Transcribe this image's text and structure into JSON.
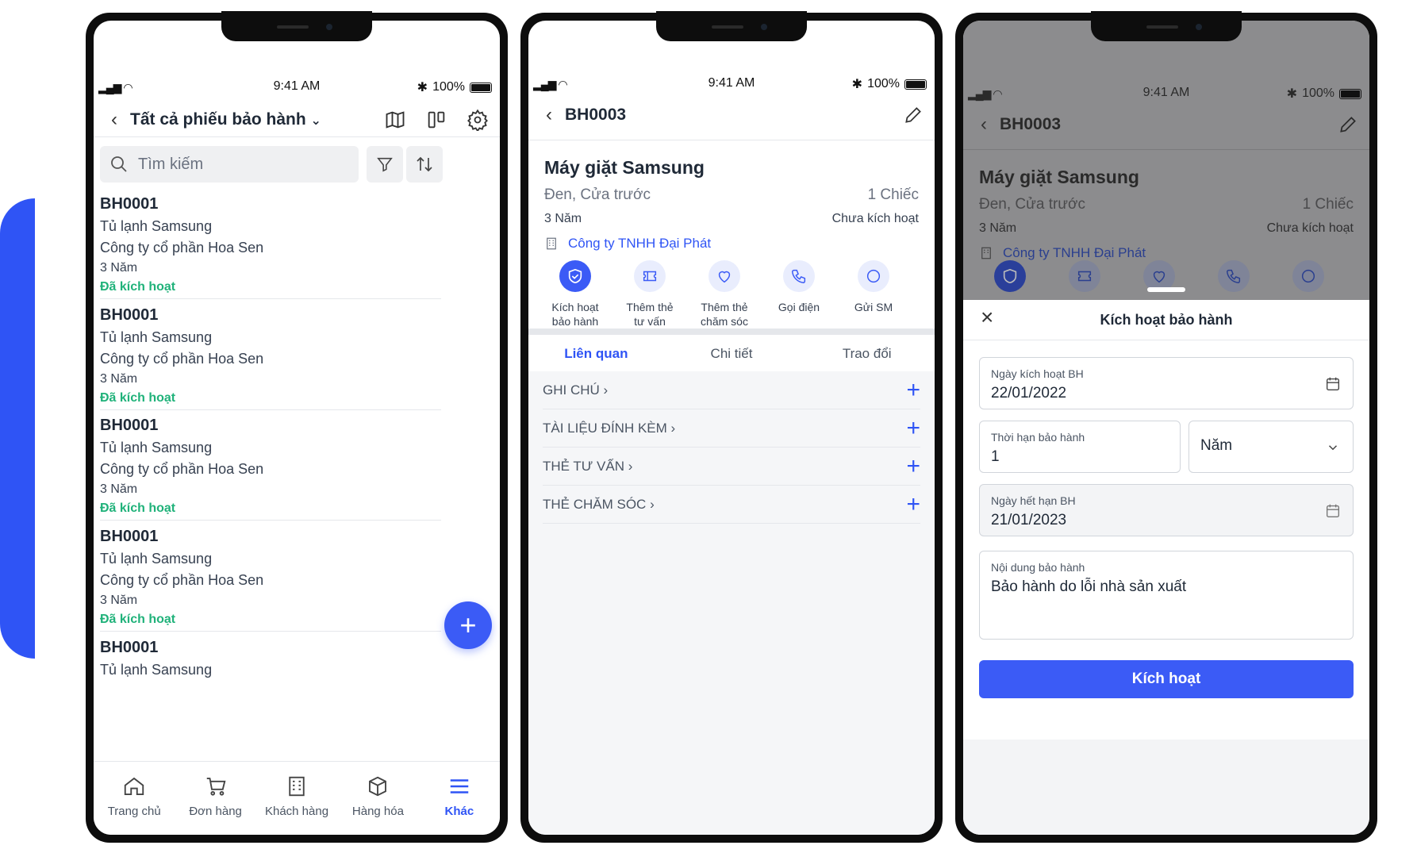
{
  "status": {
    "time": "9:41 AM",
    "battery": "100%"
  },
  "list_screen": {
    "header_title": "Tất cả phiếu bảo hành",
    "search_placeholder": "Tìm kiếm",
    "items": [
      {
        "code": "BH0001",
        "product": "Tủ lạnh Samsung",
        "company": "Công ty cổ phần Hoa Sen",
        "duration": "3 Năm",
        "status": "Đã kích hoạt"
      },
      {
        "code": "BH0001",
        "product": "Tủ lạnh Samsung",
        "company": "Công ty cổ phần Hoa Sen",
        "duration": "3 Năm",
        "status": "Đã kích hoạt"
      },
      {
        "code": "BH0001",
        "product": "Tủ lạnh Samsung",
        "company": "Công ty cổ phần Hoa Sen",
        "duration": "3 Năm",
        "status": "Đã kích hoạt"
      },
      {
        "code": "BH0001",
        "product": "Tủ lạnh Samsung",
        "company": "Công ty cổ phần Hoa Sen",
        "duration": "3 Năm",
        "status": "Đã kích hoạt"
      },
      {
        "code": "BH0001",
        "product": "Tủ lạnh Samsung"
      }
    ],
    "tabbar": [
      {
        "label": "Trang chủ",
        "icon": "home-icon"
      },
      {
        "label": "Đơn hàng",
        "icon": "cart-icon"
      },
      {
        "label": "Khách hàng",
        "icon": "building-icon"
      },
      {
        "label": "Hàng hóa",
        "icon": "box-icon"
      },
      {
        "label": "Khác",
        "icon": "menu-icon",
        "active": true
      }
    ]
  },
  "detail_screen": {
    "code": "BH0003",
    "product_name": "Máy giặt Samsung",
    "variant": "Đen, Cửa trước",
    "quantity": "1 Chiếc",
    "duration": "3 Năm",
    "activation_status": "Chưa kích hoạt",
    "company": "Công ty TNHH Đại Phát",
    "actions": [
      {
        "line1": "Kích hoạt",
        "line2": "bảo hành",
        "icon": "shield-icon"
      },
      {
        "line1": "Thêm thẻ",
        "line2": "tư vấn",
        "icon": "ticket-icon"
      },
      {
        "line1": "Thêm thẻ",
        "line2": "chăm sóc",
        "icon": "heart-icon"
      },
      {
        "line1": "Gọi điện",
        "line2": "",
        "icon": "phone-icon"
      },
      {
        "line1": "Gửi SM",
        "line2": "",
        "icon": "message-icon"
      }
    ],
    "tabs": [
      "Liên quan",
      "Chi tiết",
      "Trao đổi"
    ],
    "related": [
      "GHI CHÚ",
      "TÀI LIỆU ĐÍNH KÈM",
      "THẺ TƯ VẤN",
      "THẺ CHĂM SÓC"
    ]
  },
  "activate_sheet": {
    "title": "Kích hoạt bảo hành",
    "activation_date_label": "Ngày kích hoạt BH",
    "activation_date": "22/01/2022",
    "period_label": "Thời hạn bảo hành",
    "period_value": "1",
    "period_unit": "Năm",
    "expiry_label": "Ngày hết hạn BH",
    "expiry_date": "21/01/2023",
    "content_label": "Nội dung bảo hành",
    "content_value": "Bảo hành do lỗi nhà sản xuất",
    "submit_label": "Kích hoạt"
  },
  "colors": {
    "accent": "#3b5bf6",
    "success": "#20b27a",
    "decor": "#2f54f5"
  }
}
